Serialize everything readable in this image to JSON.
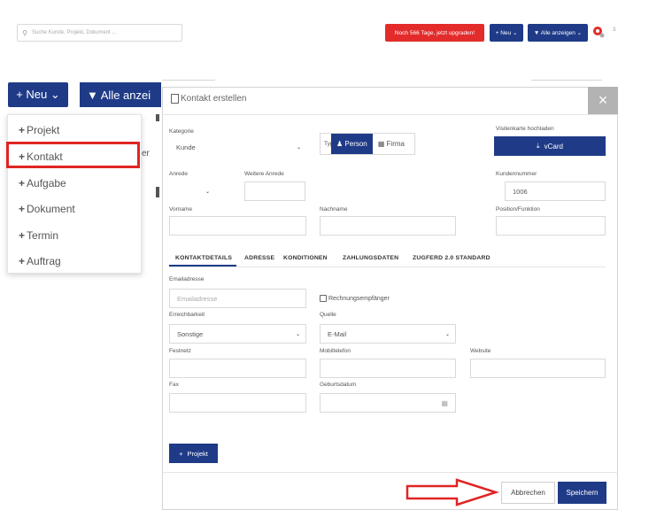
{
  "topbar": {
    "search_placeholder": "Suche Kunde, Projekt, Dokument ...",
    "upgrade_label": "Noch 566 Tage, jetzt upgraden!",
    "neu_label": "+ Neu ⌄",
    "alle_label": "▼ Alle anzeigen ⌄",
    "notif_count": "3"
  },
  "left": {
    "neu_label": "+ Neu ⌄",
    "alle_label": "▼ Alle anzei"
  },
  "menu": {
    "items": [
      "Projekt",
      "Kontakt",
      "Aufgabe",
      "Dokument",
      "Termin",
      "Auftrag"
    ],
    "highlighted": "Kontakt"
  },
  "stray_text": "er",
  "modal": {
    "title": "Kontakt erstellen",
    "close": "×",
    "kategorie_label": "Kategorie",
    "kategorie_value": "Kunde",
    "typ_label": "Typ",
    "typ_person": "Person",
    "typ_firma": "Firma",
    "visitenkarte_label": "Visitenkarte hochladen",
    "vcard_label": "vCard",
    "anrede_label": "Anrede",
    "weitere_anrede_label": "Weitere Anrede",
    "kundennummer_label": "Kundennummer",
    "kundennummer_value": "1006",
    "vorname_label": "Vorname",
    "nachname_label": "Nachname",
    "position_label": "Position/Funktion",
    "tabs": [
      "KONTAKTDETAILS",
      "ADRESSE",
      "KONDITIONEN",
      "ZAHLUNGSDATEN",
      "ZUGFERD 2.0 STANDARD"
    ],
    "email_label": "Emailadresse",
    "email_placeholder": "Emailadresse",
    "rechnung_label": "Rechnungsempfänger",
    "erreichbarkeit_label": "Erreichbarkeit",
    "erreichbarkeit_value": "Sonstige",
    "quelle_label": "Quelle",
    "quelle_value": "E-Mail",
    "festnetz_label": "Festnetz",
    "mobil_label": "Mobiltelefon",
    "website_label": "Website",
    "fax_label": "Fax",
    "geburtsdatum_label": "Geburtsdatum",
    "projekt_button": "Projekt",
    "cancel_button": "Abbrechen",
    "save_button": "Speichern"
  },
  "colors": {
    "primary": "#1f3b87",
    "upgrade": "#e32b2b",
    "highlight": "#e02424",
    "close_bg": "#b3b3b3"
  }
}
